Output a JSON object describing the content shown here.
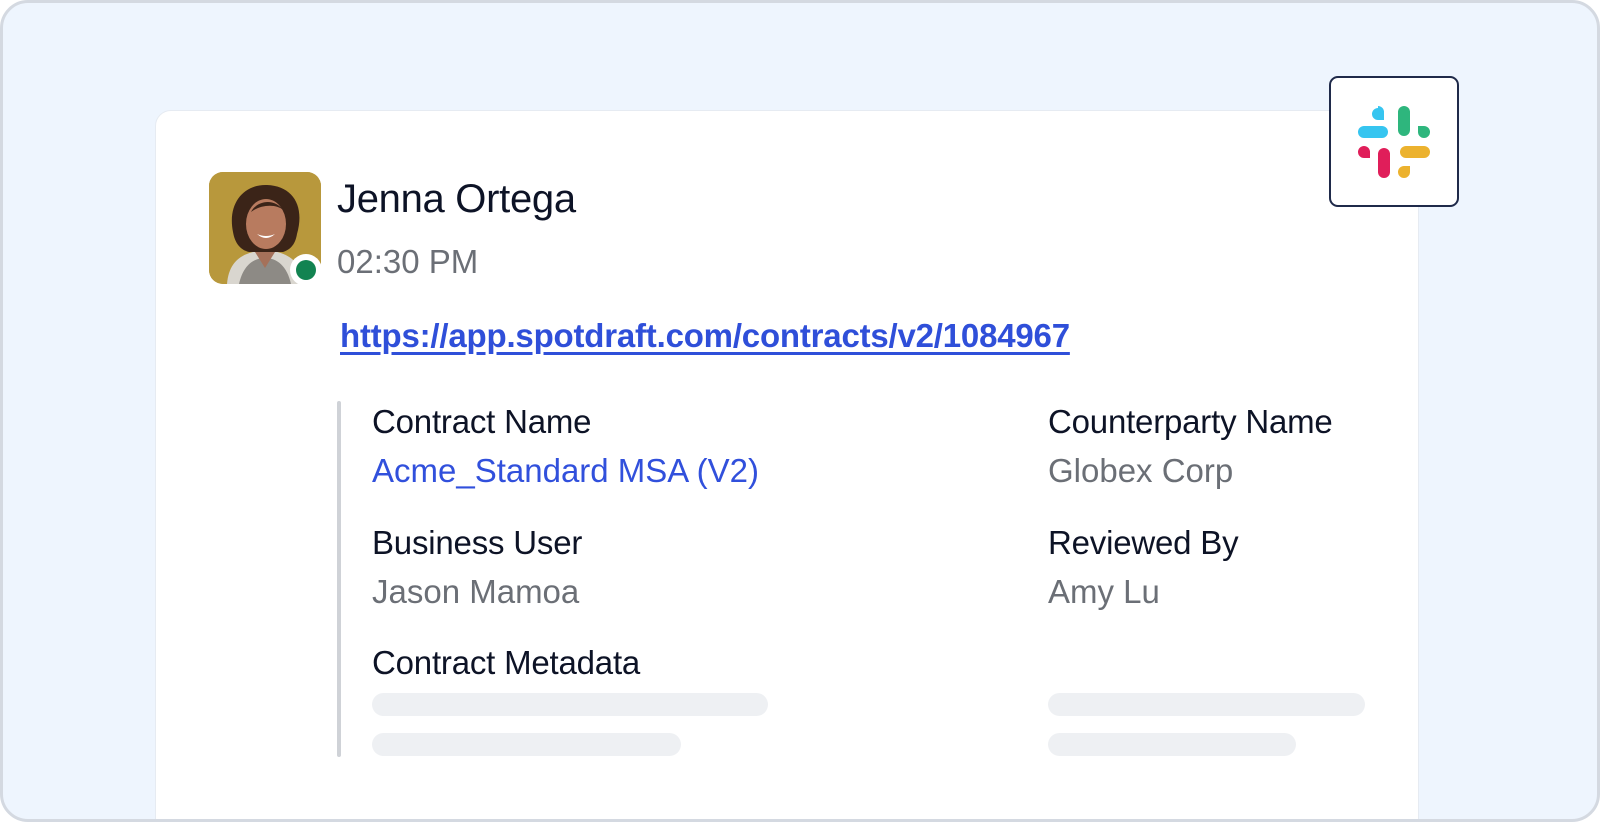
{
  "message": {
    "author": "Jenna Ortega",
    "time": "02:30 PM",
    "online": true,
    "link": "https://app.spotdraft.com/contracts/v2/1084967"
  },
  "fields": {
    "contract_name_label": "Contract Name",
    "contract_name_value": "Acme_Standard MSA (V2)",
    "counterparty_label": "Counterparty Name",
    "counterparty_value": "Globex Corp",
    "business_user_label": "Business User",
    "business_user_value": "Jason Mamoa",
    "reviewed_by_label": "Reviewed By",
    "reviewed_by_value": "Amy Lu",
    "metadata_label": "Contract Metadata"
  },
  "icons": {
    "app": "slack-icon",
    "presence": "online-status-dot"
  },
  "colors": {
    "link": "#2f4fd9",
    "online": "#128351",
    "label": "#0d1326",
    "value": "#6b6f76",
    "slack_blue": "#36c5f0",
    "slack_green": "#2eb67d",
    "slack_yellow": "#ecb22e",
    "slack_red": "#e01e5a"
  }
}
